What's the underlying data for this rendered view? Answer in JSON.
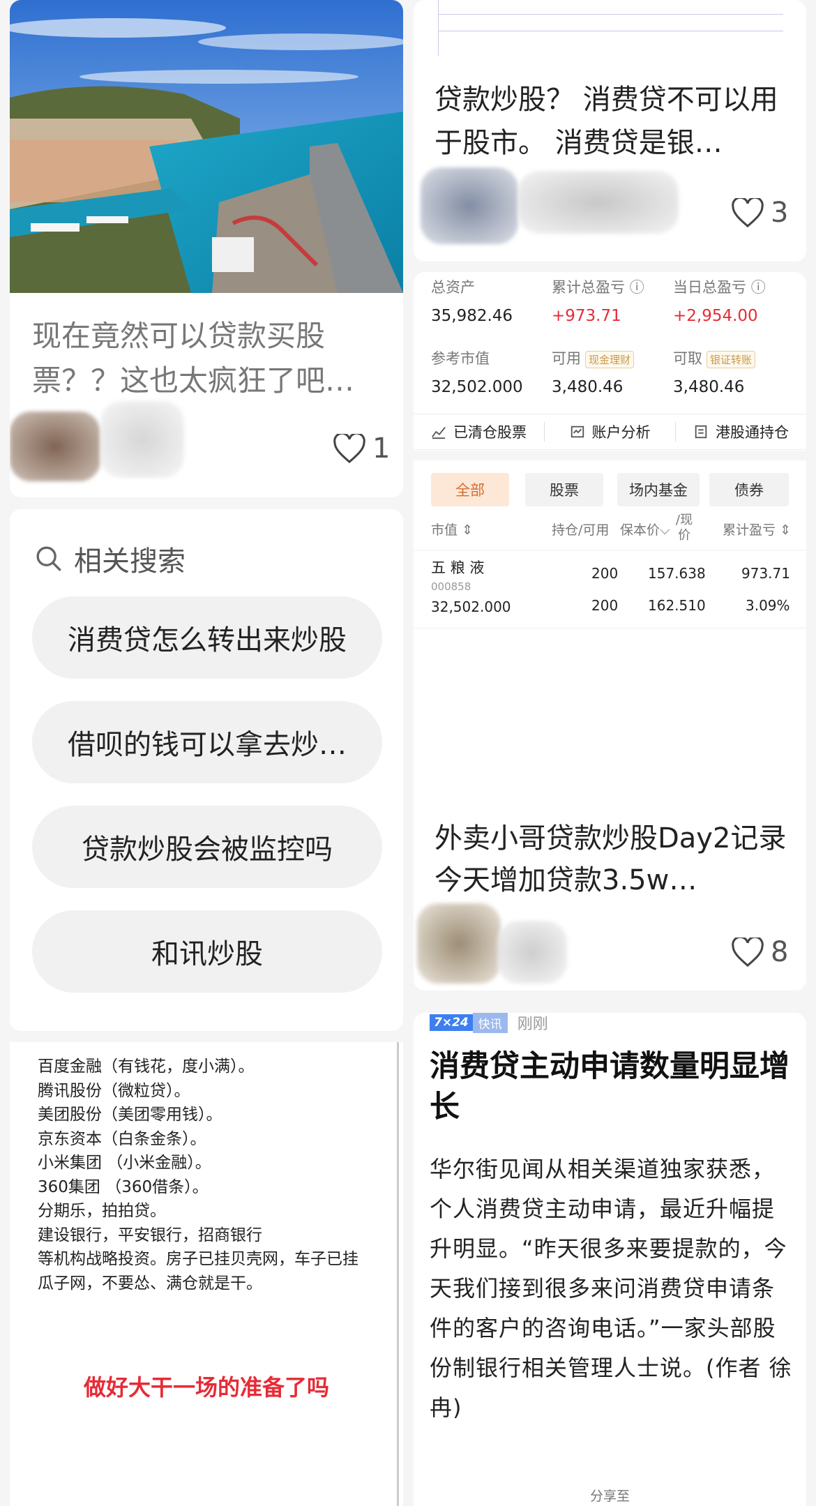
{
  "card_nice": {
    "title": "现在竟然可以贷款买股票？？这也太疯狂了吧…",
    "likes": "1"
  },
  "related_search": {
    "heading": "相关搜索",
    "items": [
      "消费贷怎么转出来炒股",
      "借呗的钱可以拿去炒…",
      "贷款炒股会被监控吗",
      "和讯炒股"
    ]
  },
  "doc_card": {
    "lines": [
      "百度金融（有钱花，度小满）。",
      "腾讯股份（微粒贷）。",
      "美团股份（美团零用钱）。",
      "京东资本（白条金条）。",
      "小米集团 （小米金融）。",
      "360集团 （360借条）。",
      "分期乐，拍拍贷。",
      "建设银行，平安银行，招商银行",
      "等机构战略投资。房子已挂贝壳网，车子已挂",
      "瓜子网，不要怂、满仓就是干。"
    ],
    "red_text": "做好大干一场的准备了吗"
  },
  "card_loan": {
    "title": "贷款炒股？ 消费贷不可以用于股市。 消费贷是银…",
    "likes": "3"
  },
  "broker": {
    "stats": {
      "total_assets_label": "总资产",
      "total_assets": "35,982.46",
      "cum_pl_label": "累计总盈亏",
      "cum_pl": "+973.71",
      "day_pl_label": "当日总盈亏",
      "day_pl": "+2,954.00",
      "market_value_label": "参考市值",
      "market_value": "32,502.000",
      "available_label": "可用",
      "available_tag": "现金理财",
      "available": "3,480.46",
      "withdrawable_label": "可取",
      "withdrawable_tag": "银证转账",
      "withdrawable": "3,480.46"
    },
    "tabs": [
      "已清仓股票",
      "账户分析",
      "港股通持仓"
    ],
    "filters": [
      "全部",
      "股票",
      "场内基金",
      "债券"
    ],
    "headers": {
      "mv": "市值",
      "pos": "持仓/可用",
      "cost": "保本价",
      "now_top": "/现",
      "now_bottom": "价",
      "pl": "累计盈亏"
    },
    "holding": {
      "name": "五 粮 液",
      "code": "000858",
      "market_value": "32,502.000",
      "position": "200",
      "available": "200",
      "cost": "157.638",
      "price": "162.510",
      "pl": "973.71",
      "pl_pct": "3.09%"
    },
    "post_title": "外卖小哥贷款炒股Day2记录 今天增加贷款3.5w…",
    "likes": "8"
  },
  "news": {
    "badge_main": "7×24",
    "badge_sub": "快讯",
    "time": "刚刚",
    "headline": "消费贷主动申请数量明显增长",
    "body": "华尔街见闻从相关渠道独家获悉，个人消费贷主动申请，最近升幅提升明显。“昨天很多来要提款的，今天我们接到很多来问消费贷申请条件的客户的咨询电话。”一家头部股份制银行相关管理人士说。(作者 徐冉)",
    "share": "分享至"
  }
}
